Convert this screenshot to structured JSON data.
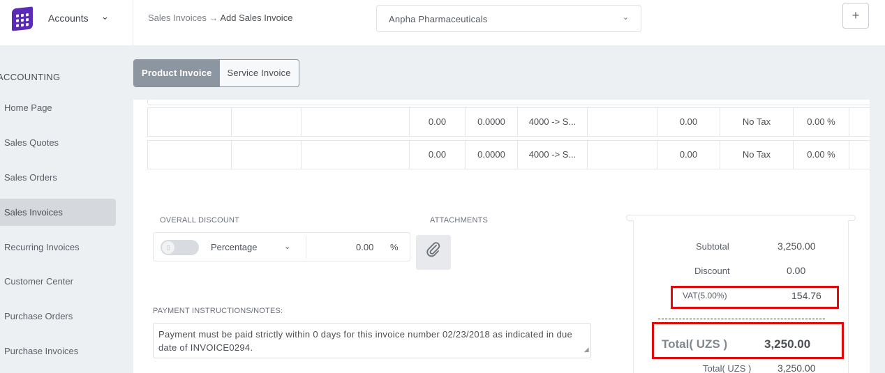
{
  "header": {
    "app_title": "Accounts",
    "breadcrumb_parent": "Sales Invoices",
    "breadcrumb_arrow": "→",
    "breadcrumb_current": "Add Sales Invoice",
    "company": "Anpha Pharmaceuticals",
    "plus_label": "+"
  },
  "sidebar": {
    "section": "ACCOUNTING",
    "items": [
      {
        "label": "Home Page"
      },
      {
        "label": "Sales Quotes"
      },
      {
        "label": "Sales Orders"
      },
      {
        "label": "Sales Invoices"
      },
      {
        "label": "Recurring Invoices"
      },
      {
        "label": "Customer Center"
      },
      {
        "label": "Purchase Orders"
      },
      {
        "label": "Purchase Invoices"
      }
    ],
    "active_index": 3
  },
  "tabs": [
    {
      "label": "Product Invoice",
      "active": true
    },
    {
      "label": "Service Invoice",
      "active": false
    }
  ],
  "line_items": [
    {
      "c1": "",
      "c2": "",
      "c3": "",
      "qty": "0.00",
      "rate": "0.0000",
      "account": "4000 -> S...",
      "c7": "",
      "amount": "0.00",
      "tax": "No Tax",
      "tax_pct": "0.00 %"
    },
    {
      "c1": "",
      "c2": "",
      "c3": "",
      "qty": "0.00",
      "rate": "0.0000",
      "account": "4000 -> S...",
      "c7": "",
      "amount": "0.00",
      "tax": "No Tax",
      "tax_pct": "0.00 %"
    }
  ],
  "discount": {
    "label": "OVERALL DISCOUNT",
    "type": "Percentage",
    "value": "0.00",
    "unit": "%",
    "enabled": false
  },
  "attachments": {
    "label": "ATTACHMENTS"
  },
  "notes": {
    "label": "PAYMENT INSTRUCTIONS/NOTES:",
    "text": "Payment must be paid strictly within 0 days for this invoice number 02/23/2018 as indicated in due date of INVOICE0294."
  },
  "summary": {
    "subtotal_label": "Subtotal",
    "subtotal": "3,250.00",
    "discount_label": "Discount",
    "discount": "0.00",
    "vat_label": "VAT(5.00%)",
    "vat": "154.76",
    "total_label": "Total( UZS )",
    "total": "3,250.00",
    "total2_label": "Total( UZS )",
    "total2": "3,250.00"
  },
  "colors": {
    "brand": "#5b2bb5",
    "highlight": "#e00b0b",
    "active_tab": "#8c96a0"
  }
}
